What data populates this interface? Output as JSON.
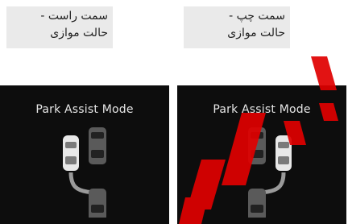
{
  "panels": [
    {
      "caption_line1": "سمت راست -",
      "caption_line2": "حالت موازی",
      "mode_title": "Park Assist Mode",
      "diagram_icon": "parking-right-parallel-icon"
    },
    {
      "caption_line1": "سمت چپ -",
      "caption_line2": "حالت موازی",
      "mode_title": "Park Assist Mode",
      "diagram_icon": "parking-left-parallel-icon"
    }
  ],
  "colors": {
    "screen_bg": "#0d0d0d",
    "watermark": "#e00000"
  },
  "watermark_icon": "red-diagonal-watermark-icon"
}
